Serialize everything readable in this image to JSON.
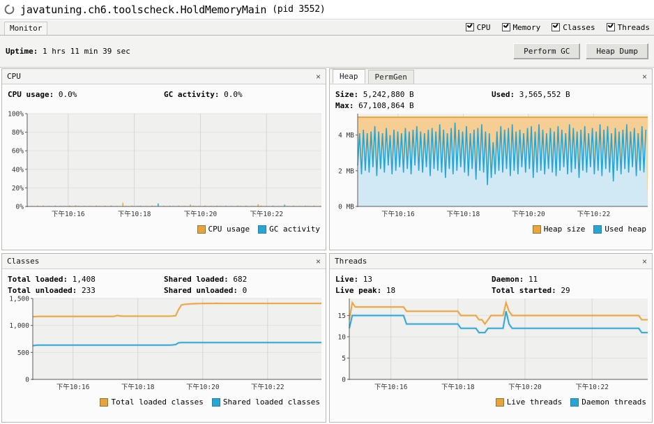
{
  "window": {
    "icon": "jconsole-loading-icon",
    "title": "javatuning.ch6.toolscheck.HoldMemoryMain",
    "pid": "(pid 3552)"
  },
  "menubar": {
    "tab_label": "Monitor",
    "checkboxes": [
      {
        "label": "CPU",
        "checked": true
      },
      {
        "label": "Memory",
        "checked": true
      },
      {
        "label": "Classes",
        "checked": true
      },
      {
        "label": "Threads",
        "checked": true
      }
    ]
  },
  "toolbar": {
    "uptime_label": "Uptime:",
    "uptime_value": "1 hrs 11 min 39 sec",
    "perform_gc_label": "Perform GC",
    "heap_dump_label": "Heap Dump"
  },
  "cpu_panel": {
    "title": "CPU",
    "close": "×",
    "stats": [
      {
        "label": "CPU usage:",
        "value": "0.0%"
      },
      {
        "label": "GC activity:",
        "value": "0.0%"
      }
    ]
  },
  "memory_panel": {
    "tabs": [
      {
        "label": "Heap",
        "active": true
      },
      {
        "label": "PermGen",
        "active": false
      }
    ],
    "close": "×",
    "stats": [
      {
        "label": "Size:",
        "value": "5,242,880 B"
      },
      {
        "label": "Used:",
        "value": "3,565,552 B"
      },
      {
        "label": "Max:",
        "value": "67,108,864 B"
      }
    ]
  },
  "classes_panel": {
    "title": "Classes",
    "close": "×",
    "stats": [
      {
        "label": "Total loaded:",
        "value": "1,408"
      },
      {
        "label": "Shared loaded:",
        "value": "682"
      },
      {
        "label": "Total unloaded:",
        "value": "233"
      },
      {
        "label": "Shared unloaded:",
        "value": "0"
      }
    ]
  },
  "threads_panel": {
    "title": "Threads",
    "close": "×",
    "stats": [
      {
        "label": "Live:",
        "value": "13"
      },
      {
        "label": "Daemon:",
        "value": "11"
      },
      {
        "label": "Live peak:",
        "value": "18"
      },
      {
        "label": "Total started:",
        "value": "29"
      }
    ]
  },
  "colors": {
    "orange": "#e8a33d",
    "orange_fill": "#f6cd92",
    "blue": "#29a5d4",
    "blue_fill": "#cfeafb",
    "plot_bg": "#f0f0ee",
    "grid": "#e2e2e0"
  },
  "chart_data": [
    {
      "type": "line",
      "id": "cpu-chart",
      "title": "CPU",
      "xlabel": "",
      "ylabel": "",
      "ylim": [
        0,
        100
      ],
      "yticks": [
        0,
        20,
        40,
        60,
        80,
        100
      ],
      "ytick_labels": [
        "0%",
        "20%",
        "40%",
        "60%",
        "80%",
        "100%"
      ],
      "xticks": [
        "下午10:16",
        "下午10:18",
        "下午10:20",
        "下午10:22"
      ],
      "grid": true,
      "legend_position": "bottom-right",
      "series": [
        {
          "name": "CPU usage",
          "color": "#e8a33d",
          "values": [
            0.3,
            0.5,
            0.4,
            0.8,
            0.3,
            1.0,
            0.4,
            0.5,
            0.3,
            0.9,
            0.4,
            0.5,
            0.6,
            0.3,
            0.8,
            0.4,
            1.1,
            0.5,
            0.3,
            0.7,
            0.4,
            0.6,
            0.3,
            0.9,
            0.5,
            0.4,
            0.8,
            0.3,
            1.0,
            0.4,
            0.5,
            0.3,
            4.0,
            0.6,
            0.4,
            0.8,
            0.3,
            0.5,
            1.0,
            0.4,
            0.6,
            0.3,
            0.9,
            0.5,
            2.6,
            0.4,
            0.7,
            0.3,
            0.8,
            0.5,
            0.4,
            1.0,
            0.3,
            0.6,
            0.4,
            2.2,
            0.8,
            0.3,
            0.5,
            0.4,
            0.9,
            0.3,
            0.6,
            0.4,
            0.8,
            0.5,
            0.3,
            1.0,
            0.4,
            0.6,
            0.3,
            0.8,
            0.5,
            0.4,
            0.9,
            0.3,
            0.6,
            0.4,
            2.4,
            0.8,
            0.3,
            0.5,
            0.4,
            1.0,
            0.3,
            0.6,
            0.4,
            0.8,
            0.5,
            0.3,
            0.9,
            0.4,
            0.6,
            0.3,
            0.8,
            0.5,
            0.4,
            1.0,
            0.3,
            0.6
          ]
        },
        {
          "name": "GC activity",
          "color": "#29a5d4",
          "values": [
            0.2,
            0.1,
            0.3,
            0.2,
            0.1,
            0.3,
            0.2,
            0.1,
            0.4,
            0.2,
            0.1,
            0.3,
            0.2,
            0.4,
            0.1,
            0.2,
            0.3,
            0.1,
            0.2,
            0.4,
            0.1,
            0.3,
            0.2,
            0.1,
            0.4,
            0.2,
            0.3,
            0.1,
            0.2,
            0.4,
            0.1,
            0.2,
            0.3,
            0.1,
            0.4,
            0.2,
            0.1,
            0.3,
            0.2,
            0.4,
            0.1,
            0.2,
            0.3,
            0.1,
            3.2,
            0.2,
            0.4,
            0.1,
            0.3,
            0.2,
            0.1,
            0.4,
            0.2,
            0.3,
            0.1,
            0.2,
            0.4,
            0.1,
            0.3,
            0.2,
            0.1,
            0.4,
            0.2,
            0.3,
            0.1,
            0.2,
            0.4,
            0.1,
            0.3,
            0.2,
            0.4,
            0.1,
            0.2,
            0.3,
            0.1,
            0.4,
            0.2,
            0.1,
            0.3,
            0.2,
            0.4,
            0.1,
            0.2,
            0.3,
            0.1,
            0.4,
            0.2,
            1.9,
            0.3,
            0.1,
            0.2,
            0.4,
            0.1,
            0.3,
            0.2,
            0.1,
            0.4,
            0.2,
            0.3,
            0.1
          ]
        }
      ]
    },
    {
      "type": "area",
      "id": "heap-chart",
      "title": "Heap",
      "xlabel": "",
      "ylabel": "",
      "ylim": [
        0,
        5.2
      ],
      "yticks": [
        0,
        2,
        4
      ],
      "ytick_labels": [
        "0 MB",
        "2 MB",
        "4 MB"
      ],
      "xticks": [
        "下午10:16",
        "下午10:18",
        "下午10:20",
        "下午10:22"
      ],
      "grid": true,
      "legend_position": "bottom-right",
      "heap_size_mb": 5.0,
      "series": [
        {
          "name": "Heap size",
          "color": "#e8a33d",
          "constant": 5.0
        },
        {
          "name": "Used heap",
          "color": "#29a5d4",
          "sawtooth": {
            "peaks": [
              4.1,
              4.3,
              4.1,
              4.2,
              4.5,
              4.2,
              4.1,
              4.4,
              4.0,
              4.3,
              4.2,
              4.1,
              4.4,
              4.2,
              4.3,
              4.5,
              4.2,
              4.1,
              4.3,
              4.4,
              4.2,
              4.6,
              4.3,
              4.1,
              4.4,
              4.7,
              4.3,
              4.2,
              4.5,
              4.1,
              4.3,
              4.4,
              4.6,
              4.2,
              4.1,
              3.6,
              4.2,
              4.5,
              4.3,
              4.4,
              4.6,
              4.2,
              4.3,
              4.1,
              4.4,
              4.5,
              4.2,
              4.6,
              4.3,
              4.1,
              4.4,
              4.2,
              4.5,
              4.3,
              4.1,
              4.6,
              4.4,
              4.2,
              4.3,
              4.5,
              4.1,
              4.4,
              4.2,
              4.6,
              4.3,
              4.5,
              4.1,
              4.4,
              4.2,
              4.3,
              4.6,
              4.2,
              4.4,
              4.1,
              4.5,
              4.3
            ],
            "troughs": [
              2.3,
              1.8,
              2.0,
              1.9,
              2.2,
              1.7,
              2.1,
              1.9,
              2.3,
              1.8,
              2.0,
              2.2,
              1.9,
              2.1,
              1.8,
              2.3,
              2.0,
              1.9,
              2.2,
              1.7,
              2.1,
              2.0,
              1.9,
              1.6,
              2.1,
              1.8,
              2.0,
              2.2,
              1.9,
              1.7,
              2.1,
              1.5,
              2.0,
              1.9,
              1.2,
              1.6,
              1.8,
              2.0,
              1.9,
              2.1,
              1.7,
              2.0,
              1.8,
              2.2,
              1.9,
              2.1,
              1.6,
              1.9,
              2.0,
              1.8,
              2.1,
              1.9,
              1.7,
              2.0,
              2.2,
              1.8,
              1.9,
              2.1,
              1.6,
              2.0,
              1.9,
              2.2,
              1.8,
              2.0,
              1.7,
              2.1,
              1.9,
              1.4,
              2.0,
              1.8,
              2.1,
              1.9,
              2.2,
              1.7,
              2.0,
              1.9
            ]
          }
        }
      ]
    },
    {
      "type": "line",
      "id": "classes-chart",
      "title": "Classes",
      "xlabel": "",
      "ylabel": "",
      "ylim": [
        0,
        1500
      ],
      "yticks": [
        0,
        500,
        1000,
        1500
      ],
      "ytick_labels": [
        "0",
        "500",
        "1,000",
        "1,500"
      ],
      "xticks": [
        "下午10:16",
        "下午10:18",
        "下午10:20",
        "下午10:22"
      ],
      "grid": true,
      "legend_position": "bottom-right",
      "series": [
        {
          "name": "Total loaded classes",
          "color": "#e8a33d",
          "values": [
            1160,
            1165,
            1168,
            1168,
            1168,
            1168,
            1168,
            1168,
            1168,
            1168,
            1168,
            1168,
            1168,
            1168,
            1168,
            1168,
            1168,
            1168,
            1168,
            1168,
            1168,
            1168,
            1168,
            1168,
            1168,
            1168,
            1168,
            1168,
            1170,
            1185,
            1175,
            1172,
            1172,
            1172,
            1172,
            1172,
            1172,
            1172,
            1172,
            1172,
            1172,
            1172,
            1172,
            1172,
            1172,
            1172,
            1172,
            1172,
            1175,
            1180,
            1295,
            1380,
            1390,
            1395,
            1400,
            1402,
            1404,
            1405,
            1406,
            1407,
            1408,
            1408,
            1408,
            1410,
            1408,
            1408,
            1408,
            1408,
            1408,
            1408,
            1408,
            1408,
            1408,
            1408,
            1408,
            1408,
            1408,
            1408,
            1408,
            1408,
            1408,
            1408,
            1408,
            1408,
            1408,
            1408,
            1408,
            1408,
            1408,
            1408,
            1408,
            1408,
            1408,
            1408,
            1408,
            1408,
            1408,
            1408,
            1408,
            1408
          ]
        },
        {
          "name": "Shared loaded classes",
          "color": "#29a5d4",
          "values": [
            625,
            632,
            635,
            635,
            635,
            635,
            635,
            635,
            635,
            635,
            635,
            635,
            635,
            635,
            635,
            635,
            635,
            635,
            635,
            635,
            635,
            635,
            635,
            635,
            635,
            635,
            635,
            635,
            635,
            635,
            635,
            635,
            635,
            635,
            635,
            635,
            635,
            635,
            635,
            635,
            635,
            635,
            635,
            635,
            635,
            635,
            635,
            635,
            638,
            645,
            678,
            682,
            682,
            682,
            682,
            682,
            682,
            682,
            682,
            682,
            682,
            682,
            682,
            682,
            682,
            682,
            682,
            682,
            682,
            682,
            682,
            682,
            682,
            682,
            682,
            682,
            682,
            682,
            682,
            682,
            682,
            682,
            682,
            682,
            682,
            682,
            682,
            682,
            682,
            682,
            682,
            682,
            682,
            682,
            682,
            682,
            682,
            682,
            682,
            682
          ]
        }
      ]
    },
    {
      "type": "line",
      "id": "threads-chart",
      "title": "Threads",
      "xlabel": "",
      "ylabel": "",
      "ylim": [
        0,
        19
      ],
      "yticks": [
        0,
        5,
        10,
        15
      ],
      "ytick_labels": [
        "0",
        "5",
        "10",
        "15"
      ],
      "xticks": [
        "下午10:16",
        "下午10:18",
        "下午10:20",
        "下午10:22"
      ],
      "grid": true,
      "legend_position": "bottom-right",
      "series": [
        {
          "name": "Live threads",
          "color": "#e8a33d",
          "values": [
            14,
            18,
            17,
            17,
            17,
            17,
            17,
            17,
            17,
            17,
            17,
            17,
            17,
            17,
            17,
            17,
            17,
            17,
            17,
            16,
            16,
            16,
            16,
            16,
            16,
            16,
            16,
            16,
            16,
            16,
            16,
            16,
            16,
            16,
            16,
            16,
            16,
            15,
            15,
            15,
            15,
            15,
            15,
            14,
            14,
            13,
            14,
            15,
            15,
            15,
            15,
            15,
            18,
            16,
            15,
            15,
            15,
            15,
            15,
            15,
            15,
            15,
            15,
            15,
            15,
            15,
            15,
            15,
            15,
            15,
            15,
            15,
            15,
            15,
            15,
            15,
            15,
            15,
            15,
            15,
            15,
            15,
            15,
            15,
            15,
            15,
            15,
            15,
            15,
            15,
            15,
            15,
            15,
            15,
            15,
            15,
            15,
            14,
            14,
            14
          ]
        },
        {
          "name": "Daemon threads",
          "color": "#29a5d4",
          "values": [
            12,
            15,
            15,
            15,
            15,
            15,
            15,
            15,
            15,
            15,
            15,
            15,
            15,
            15,
            15,
            15,
            15,
            15,
            15,
            13,
            13,
            13,
            13,
            13,
            13,
            13,
            13,
            13,
            13,
            13,
            13,
            13,
            13,
            13,
            13,
            13,
            13,
            12,
            12,
            12,
            12,
            12,
            12,
            11,
            11,
            11,
            12,
            12,
            12,
            12,
            12,
            12,
            16,
            13,
            12,
            12,
            12,
            12,
            12,
            12,
            12,
            12,
            12,
            12,
            12,
            12,
            12,
            12,
            12,
            12,
            12,
            12,
            12,
            12,
            12,
            12,
            12,
            12,
            12,
            12,
            12,
            12,
            12,
            12,
            12,
            12,
            12,
            12,
            12,
            12,
            12,
            12,
            12,
            12,
            12,
            12,
            12,
            11,
            11,
            11
          ]
        }
      ]
    }
  ]
}
